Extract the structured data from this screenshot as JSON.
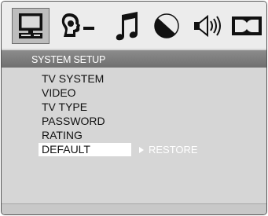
{
  "tabs": [
    {
      "icon": "monitor-icon"
    },
    {
      "icon": "speaker-settings-icon"
    },
    {
      "icon": "music-note-icon"
    },
    {
      "icon": "half-circle-video-icon"
    },
    {
      "icon": "speaker-volume-icon"
    },
    {
      "icon": "dolby-icon"
    }
  ],
  "section": {
    "title": "SYSTEM SETUP"
  },
  "menu": {
    "items": [
      {
        "label": "TV SYSTEM"
      },
      {
        "label": "VIDEO"
      },
      {
        "label": "TV TYPE"
      },
      {
        "label": "PASSWORD"
      },
      {
        "label": "RATING"
      },
      {
        "label": "DEFAULT"
      }
    ],
    "selected_submenu": "RESTORE"
  },
  "colors": {
    "background": "#d6d6d6",
    "tabbar": "#ececec",
    "title_bar": "#7a7a7a",
    "highlight": "#ffffff",
    "text": "#111111"
  }
}
